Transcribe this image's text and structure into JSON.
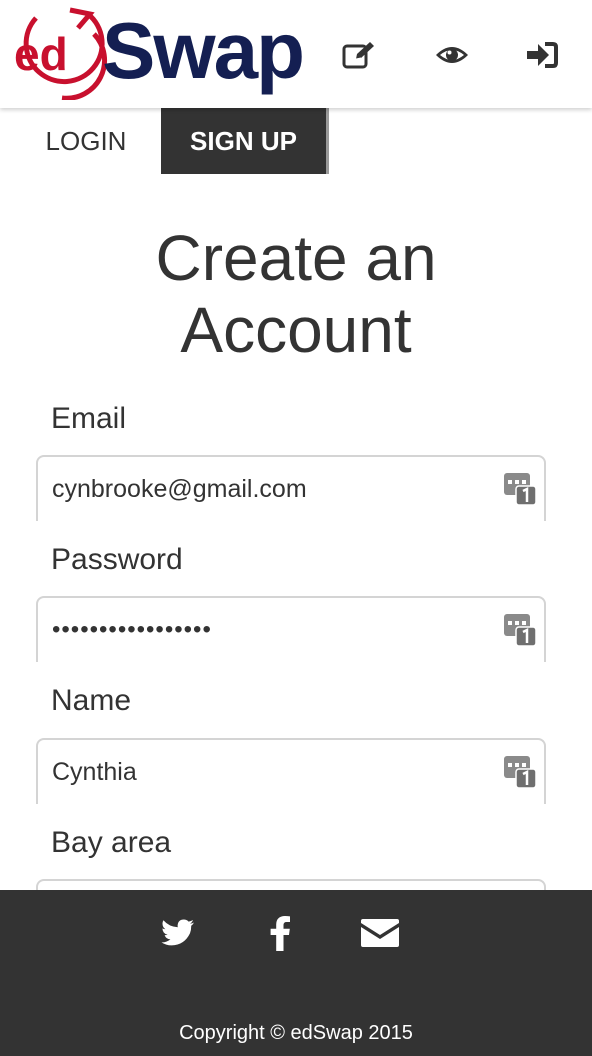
{
  "header": {
    "logo": {
      "ed": "ed",
      "swap": "Swap"
    },
    "icons": [
      "edit-icon",
      "eye-icon",
      "sign-in-icon"
    ]
  },
  "tabs": [
    {
      "label": "LOGIN",
      "active": false
    },
    {
      "label": "SIGN UP",
      "active": true
    }
  ],
  "title_line1": "Create an",
  "title_line2": "Account",
  "form": {
    "email": {
      "label": "Email",
      "value": "cynbrooke@gmail.com"
    },
    "password": {
      "label": "Password",
      "value": "•••••••••••••••••"
    },
    "name": {
      "label": "Name",
      "value": "Cynthia"
    },
    "bay_area": {
      "label": "Bay area",
      "value": ""
    }
  },
  "footer": {
    "social": [
      "twitter-icon",
      "facebook-icon",
      "mail-icon"
    ],
    "copyright": "Copyright © edSwap 2015"
  },
  "colors": {
    "brand_red": "#c8102e",
    "brand_navy": "#141f52",
    "dark": "#333333",
    "white": "#ffffff"
  }
}
